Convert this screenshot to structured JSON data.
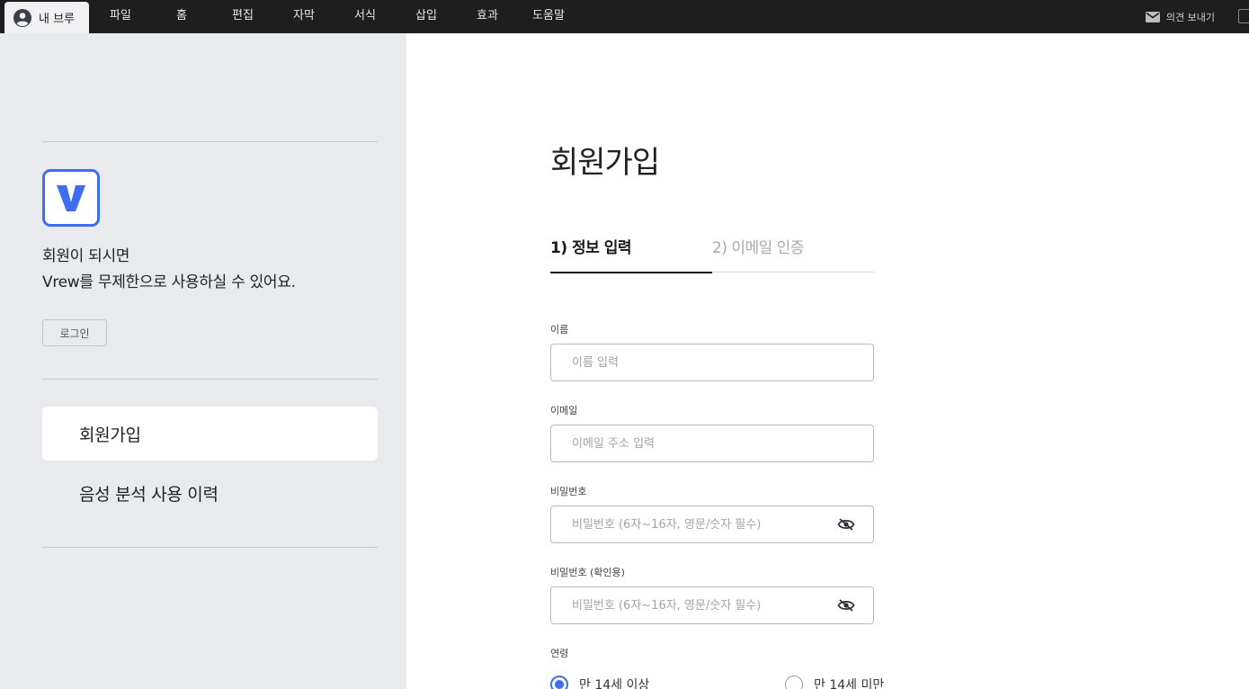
{
  "menubar": {
    "my_tab": "내 브루",
    "items": [
      "파일",
      "홈",
      "편집",
      "자막",
      "서식",
      "삽입",
      "효과",
      "도움말"
    ],
    "feedback_label": "의견 보내기"
  },
  "sidebar": {
    "promo_line1": "회원이 되시면",
    "promo_line2": "Vrew를 무제한으로 사용하실 수 있어요.",
    "login_label": "로그인",
    "nav": [
      "회원가입",
      "음성 분석 사용 이력"
    ],
    "logo_letter": "V"
  },
  "form": {
    "title": "회원가입",
    "steps": [
      "1) 정보 입력",
      "2) 이메일 인증"
    ],
    "name_label": "이름",
    "name_placeholder": "이름 입력",
    "email_label": "이메일",
    "email_placeholder": "이메일 주소 입력",
    "password_label": "비밀번호",
    "password_placeholder": "비밀번호 (6자~16자, 영문/숫자 필수)",
    "password_confirm_label": "비밀번호 (확인용)",
    "password_confirm_placeholder": "비밀번호 (6자~16자, 영문/숫자 필수)",
    "age_label": "연령",
    "age_options": [
      "만 14세 이상",
      "만 14세 미만"
    ],
    "age_selected": "만 14세 이상"
  },
  "colors": {
    "accent": "#3f6df2",
    "menubar_bg": "#1e1e1e",
    "sidebar_bg": "#e9eaee"
  }
}
